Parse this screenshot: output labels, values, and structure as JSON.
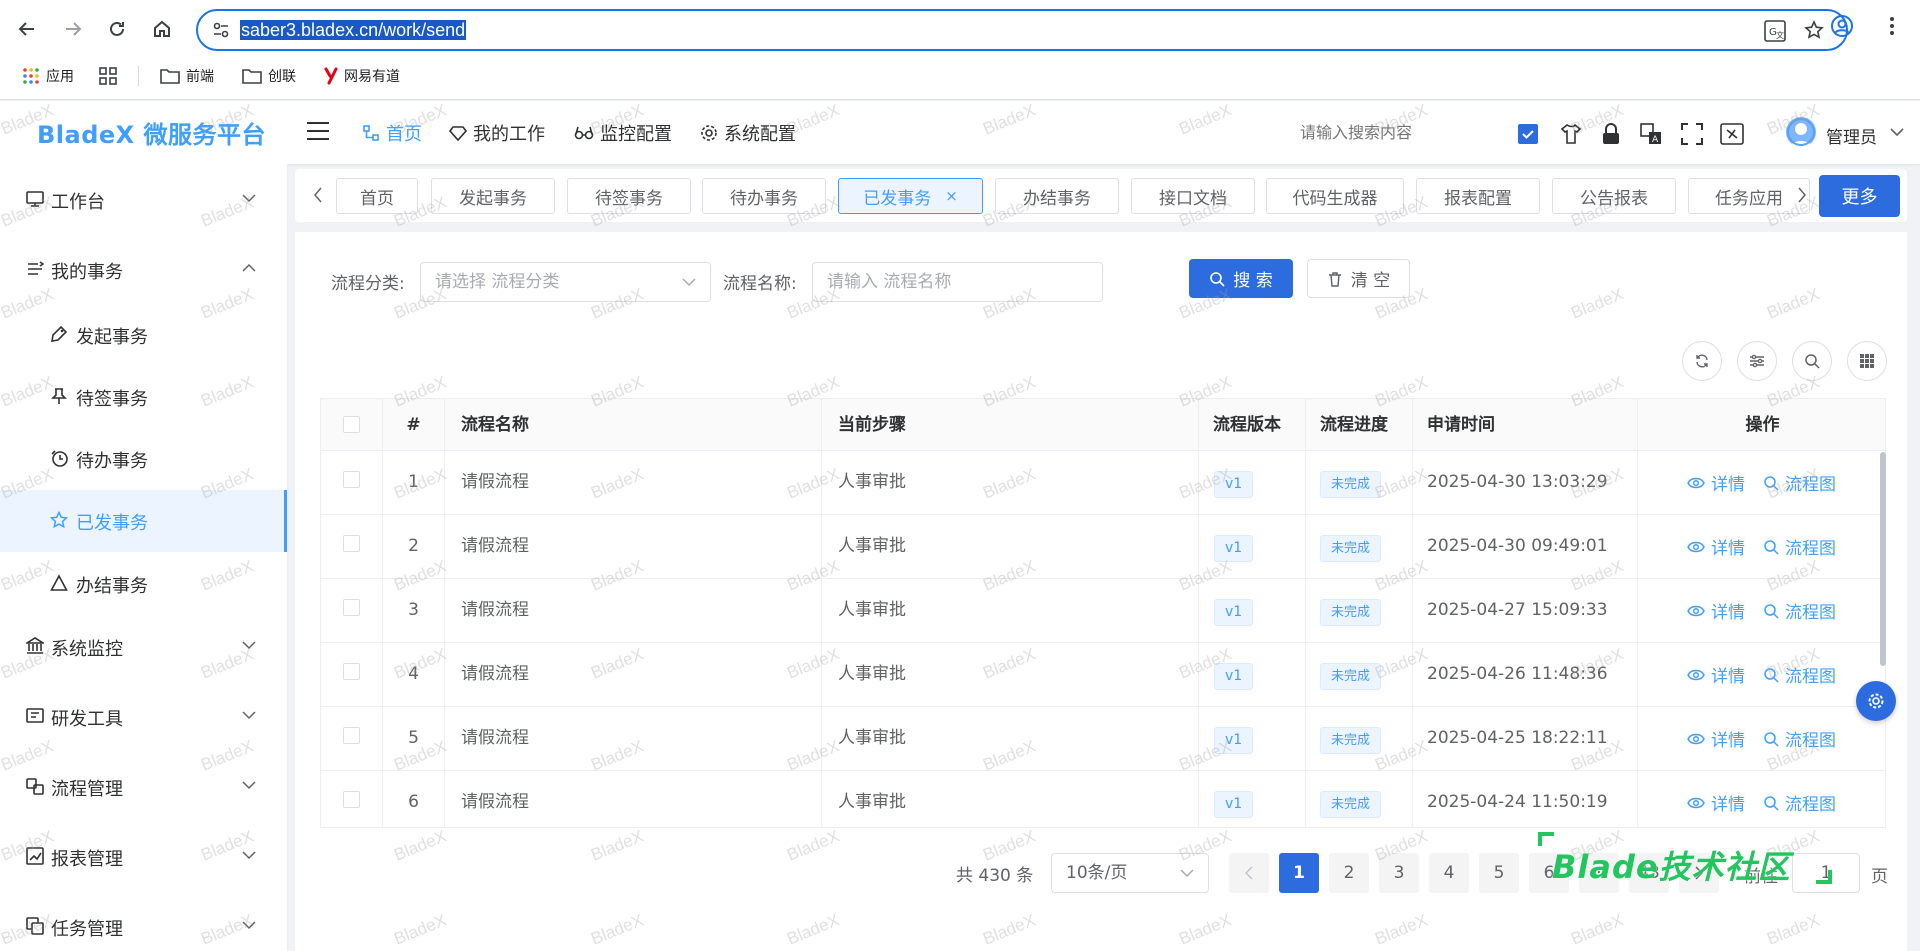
{
  "browser": {
    "url": "saber3.bladex.cn/work/send",
    "bookmarks": [
      {
        "label": "应用",
        "icon": "apps-grid-icon"
      },
      {
        "label": "",
        "icon": "tab-groups-icon"
      },
      {
        "label": "前端",
        "icon": "folder-icon"
      },
      {
        "label": "创联",
        "icon": "folder-icon"
      },
      {
        "label": "网易有道",
        "icon": "youdao-icon"
      }
    ]
  },
  "header": {
    "logo": "BladeX 微服务平台",
    "nav": [
      {
        "label": "首页",
        "icon": "home-flow-icon",
        "active": true
      },
      {
        "label": "我的工作",
        "icon": "gem-icon",
        "active": false
      },
      {
        "label": "监控配置",
        "icon": "glasses-icon",
        "active": false
      },
      {
        "label": "系统配置",
        "icon": "gear-icon",
        "active": false
      }
    ],
    "search_placeholder": "请输入搜索内容",
    "user_name": "管理员"
  },
  "sidebar": {
    "items": [
      {
        "label": "工作台",
        "icon": "monitor-icon",
        "expanded": false
      },
      {
        "label": "我的事务",
        "icon": "tasks-icon",
        "expanded": true
      },
      {
        "label": "系统监控",
        "icon": "bank-icon",
        "expanded": false
      },
      {
        "label": "研发工具",
        "icon": "dev-tools-icon",
        "expanded": false
      },
      {
        "label": "流程管理",
        "icon": "flow-icon",
        "expanded": false
      },
      {
        "label": "报表管理",
        "icon": "report-icon",
        "expanded": false
      },
      {
        "label": "任务管理",
        "icon": "task-copy-icon",
        "expanded": false
      }
    ],
    "subitems": [
      {
        "label": "发起事务",
        "icon": "tag-icon"
      },
      {
        "label": "待签事务",
        "icon": "pin-icon"
      },
      {
        "label": "待办事务",
        "icon": "clock-icon"
      },
      {
        "label": "已发事务",
        "icon": "star-icon",
        "active": true
      },
      {
        "label": "办结事务",
        "icon": "triangle-icon"
      }
    ]
  },
  "tags": [
    {
      "label": "首页"
    },
    {
      "label": "发起事务"
    },
    {
      "label": "待签事务"
    },
    {
      "label": "待办事务"
    },
    {
      "label": "已发事务",
      "active": true,
      "close": "×"
    },
    {
      "label": "办结事务"
    },
    {
      "label": "接口文档"
    },
    {
      "label": "代码生成器"
    },
    {
      "label": "报表配置"
    },
    {
      "label": "公告报表"
    },
    {
      "label": "任务应用"
    }
  ],
  "more_label": "更多",
  "filters": {
    "category_label": "流程分类:",
    "category_placeholder": "请选择 流程分类",
    "name_label": "流程名称:",
    "name_placeholder": "请输入 流程名称",
    "search_btn": "搜 索",
    "clear_btn": "清 空"
  },
  "table": {
    "columns": [
      "#",
      "流程名称",
      "当前步骤",
      "流程版本",
      "流程进度",
      "申请时间",
      "操作"
    ],
    "rows": [
      {
        "no": "1",
        "name": "请假流程",
        "step": "人事审批",
        "version": "v1",
        "progress": "未完成",
        "time": "2025-04-30 13:03:29"
      },
      {
        "no": "2",
        "name": "请假流程",
        "step": "人事审批",
        "version": "v1",
        "progress": "未完成",
        "time": "2025-04-30 09:49:01"
      },
      {
        "no": "3",
        "name": "请假流程",
        "step": "人事审批",
        "version": "v1",
        "progress": "未完成",
        "time": "2025-04-27 15:09:33"
      },
      {
        "no": "4",
        "name": "请假流程",
        "step": "人事审批",
        "version": "v1",
        "progress": "未完成",
        "time": "2025-04-26 11:48:36"
      },
      {
        "no": "5",
        "name": "请假流程",
        "step": "人事审批",
        "version": "v1",
        "progress": "未完成",
        "time": "2025-04-25 18:22:11"
      },
      {
        "no": "6",
        "name": "请假流程",
        "step": "人事审批",
        "version": "v1",
        "progress": "未完成",
        "time": "2025-04-24 11:50:19"
      }
    ],
    "action_detail": "详情",
    "action_flow": "流程图"
  },
  "pagination": {
    "total": "共 430 条",
    "page_size": "10条/页",
    "pages": [
      "1",
      "2",
      "3",
      "4",
      "5",
      "6",
      "···",
      "43"
    ],
    "current": "1",
    "jump_label": "前往",
    "jump_value": "1",
    "page_suffix": "页"
  },
  "watermark": "BladeX",
  "community_badge": "Blade技术社区",
  "colors": {
    "primary": "#409eff",
    "button": "#2d6cdf",
    "badge_green": "#22c55e"
  }
}
